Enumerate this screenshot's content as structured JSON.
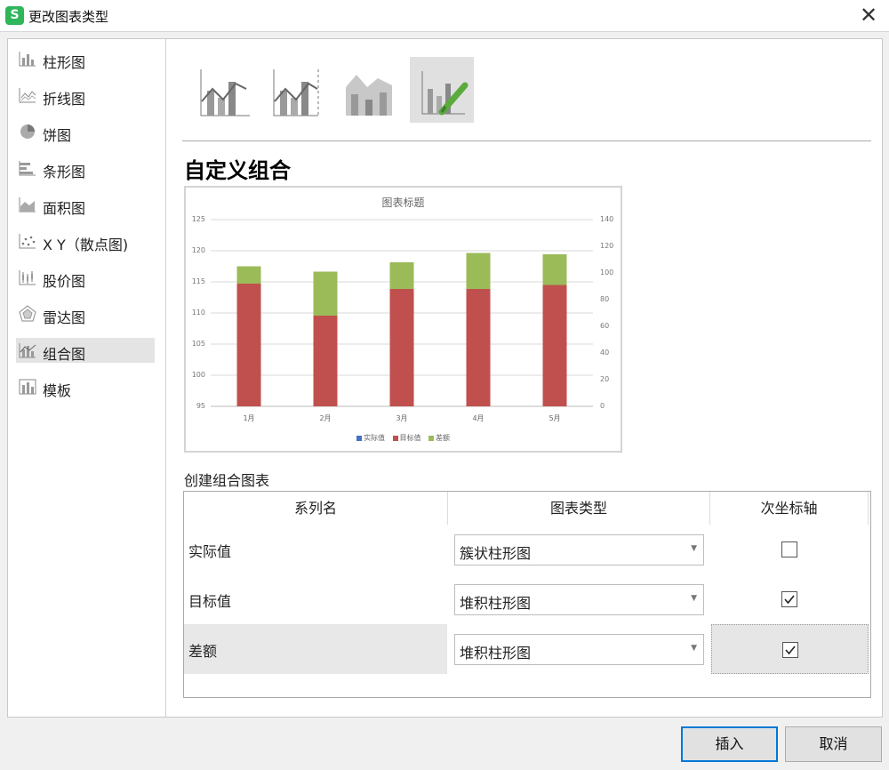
{
  "window": {
    "title": "更改图表类型",
    "close_glyph": "✕"
  },
  "sidebar": {
    "items": [
      {
        "label": "柱形图",
        "icon": "column-chart-icon"
      },
      {
        "label": "折线图",
        "icon": "line-chart-icon"
      },
      {
        "label": "饼图",
        "icon": "pie-chart-icon"
      },
      {
        "label": "条形图",
        "icon": "bar-chart-icon"
      },
      {
        "label": "面积图",
        "icon": "area-chart-icon"
      },
      {
        "label": "X Y（散点图)",
        "icon": "scatter-chart-icon"
      },
      {
        "label": "股价图",
        "icon": "stock-chart-icon"
      },
      {
        "label": "雷达图",
        "icon": "radar-chart-icon"
      },
      {
        "label": "组合图",
        "icon": "combo-chart-icon",
        "selected": true
      },
      {
        "label": "模板",
        "icon": "template-icon"
      }
    ]
  },
  "combo_types": [
    {
      "icon": "clustered-column-line-icon"
    },
    {
      "icon": "column-line-secondary-axis-icon"
    },
    {
      "icon": "stacked-area-column-icon"
    },
    {
      "icon": "custom-combo-icon",
      "selected": true
    }
  ],
  "section_title": "自定义组合",
  "preview": {
    "legend_colors": {
      "actual": "#4472c4",
      "target": "#c0504d",
      "diff": "#9bbb59"
    }
  },
  "chart_data": {
    "type": "bar",
    "title": "图表标题",
    "categories": [
      "1月",
      "2月",
      "3月",
      "4月",
      "5月"
    ],
    "ylim": [
      95,
      125
    ],
    "y_ticks": [
      95,
      100,
      105,
      110,
      115,
      120,
      125
    ],
    "y2lim": [
      0,
      140
    ],
    "y2_ticks": [
      0,
      20,
      40,
      60,
      80,
      100,
      120,
      140
    ],
    "series": [
      {
        "name": "实际值",
        "axis": "primary",
        "values": []
      },
      {
        "name": "目标值",
        "axis": "secondary",
        "stacked": true,
        "values": [
          92,
          68,
          88,
          88,
          91
        ]
      },
      {
        "name": "差额",
        "axis": "secondary",
        "stacked": true,
        "values": [
          13,
          33,
          20,
          27,
          23
        ]
      }
    ],
    "legend": [
      "实际值",
      "目标值",
      "差额"
    ],
    "legend_position": "bottom"
  },
  "combo_table": {
    "label": "创建组合图表",
    "headers": [
      "系列名",
      "图表类型",
      "次坐标轴"
    ],
    "rows": [
      {
        "series": "实际值",
        "chart_type": "簇状柱形图",
        "secondary_axis": false
      },
      {
        "series": "目标值",
        "chart_type": "堆积柱形图",
        "secondary_axis": true
      },
      {
        "series": "差额",
        "chart_type": "堆积柱形图",
        "secondary_axis": true
      }
    ]
  },
  "buttons": {
    "insert": "插入",
    "cancel": "取消"
  }
}
